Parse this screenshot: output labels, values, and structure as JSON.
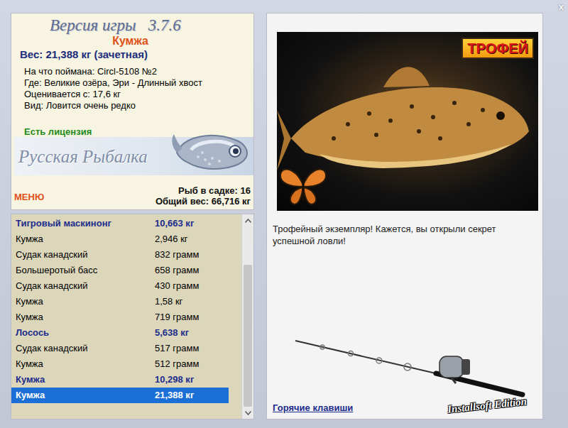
{
  "window": {
    "close": "x"
  },
  "info": {
    "version_label": "Версия игры",
    "version": "3.7.6",
    "fish": "Кумжа",
    "weight": "Вес: 21,388 кг (зачетная)",
    "details": [
      "На что поймана: Circl-5108 №2",
      "Где: Великие озёра, Эри - Длинный хвост",
      "Оценивается с: 17,6 кг",
      "Вид: Ловится очень редко"
    ],
    "license": "Есть лицензия",
    "logo": "Русская Рыбалка",
    "menu": "МЕНЮ",
    "keepnet_count": "Рыб в садке: 16",
    "keepnet_weight": "Общий вес: 66,716 кг"
  },
  "catch_list": {
    "scroll_level": 1,
    "rows": [
      {
        "name": "Тигровый маскинонг",
        "weight": "10,663 кг",
        "trophy": true,
        "selected": false
      },
      {
        "name": "Кумжа",
        "weight": "2,946 кг",
        "trophy": false,
        "selected": false
      },
      {
        "name": "Судак канадский",
        "weight": "832 грамм",
        "trophy": false,
        "selected": false
      },
      {
        "name": "Большеротый басс",
        "weight": "658 грамм",
        "trophy": false,
        "selected": false
      },
      {
        "name": "Судак канадский",
        "weight": "430 грамм",
        "trophy": false,
        "selected": false
      },
      {
        "name": "Кумжа",
        "weight": "1,58 кг",
        "trophy": false,
        "selected": false
      },
      {
        "name": "Кумжа",
        "weight": "719 грамм",
        "trophy": false,
        "selected": false
      },
      {
        "name": "Лосось",
        "weight": "5,638 кг",
        "trophy": true,
        "selected": false
      },
      {
        "name": "Судак канадский",
        "weight": "517 грамм",
        "trophy": false,
        "selected": false
      },
      {
        "name": "Кумжа",
        "weight": "512 грамм",
        "trophy": false,
        "selected": false
      },
      {
        "name": "Кумжа",
        "weight": "10,298 кг",
        "trophy": true,
        "selected": false
      },
      {
        "name": "Кумжа",
        "weight": "21,388 кг",
        "trophy": true,
        "selected": true
      }
    ]
  },
  "trophy_panel": {
    "badge": "ТРОФЕЙ",
    "message": "Трофейный экземпляр! Кажется, вы открыли секрет успешной ловли!",
    "hotkeys": "Горячие клавиши",
    "edition": "Installsoft Edition"
  }
}
